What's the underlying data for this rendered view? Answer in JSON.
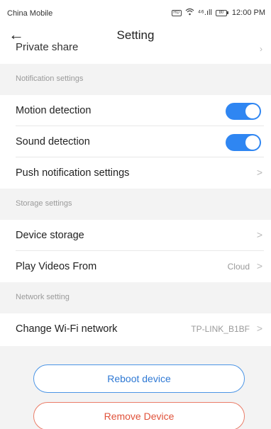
{
  "status_bar": {
    "carrier": "China Mobile",
    "hd": "HD",
    "signal": "⁴⁶.ıll",
    "battery": "80",
    "time": "12:00 PM"
  },
  "header": {
    "title": "Setting"
  },
  "partial_row": {
    "label": "Private share"
  },
  "sections": {
    "notification": "Notification settings",
    "storage": "Storage settings",
    "network": "Network setting"
  },
  "rows": {
    "motion": {
      "label": "Motion detection",
      "enabled": true
    },
    "sound": {
      "label": "Sound detection",
      "enabled": true
    },
    "push": {
      "label": "Push notification settings"
    },
    "device_storage": {
      "label": "Device storage"
    },
    "play_videos": {
      "label": "Play Videos From",
      "value": "Cloud"
    },
    "wifi": {
      "label": "Change Wi-Fi network",
      "value": "TP-LINK_B1BF"
    }
  },
  "buttons": {
    "reboot": "Reboot device",
    "remove": "Remove Device"
  },
  "colors": {
    "accent": "#2f86f2",
    "danger": "#e0523a",
    "section_bg": "#f3f3f3"
  }
}
